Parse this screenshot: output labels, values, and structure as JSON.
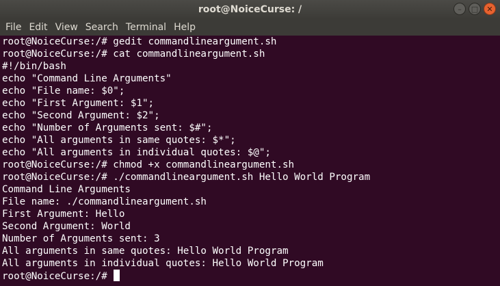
{
  "window": {
    "title": "root@NoiceCurse: /"
  },
  "menu": {
    "items": [
      "File",
      "Edit",
      "View",
      "Search",
      "Terminal",
      "Help"
    ]
  },
  "controls": {
    "minimize_icon": "minimize-icon",
    "maximize_icon": "maximize-icon",
    "close_icon": "close-icon"
  },
  "terminal": {
    "lines": [
      "root@NoiceCurse:/# gedit commandlineargument.sh",
      "root@NoiceCurse:/# cat commandlineargument.sh",
      "#!/bin/bash",
      "echo \"Command Line Arguments\"",
      "echo \"File name: $0\";",
      "echo \"First Argument: $1\";",
      "echo \"Second Argument: $2\";",
      "echo \"Number of Arguments sent: $#\";",
      "echo \"All arguments in same quotes: $*\";",
      "echo \"All arguments in individual quotes: $@\";",
      "root@NoiceCurse:/# chmod +x commandlineargument.sh",
      "root@NoiceCurse:/# ./commandlineargument.sh Hello World Program",
      "Command Line Arguments",
      "File name: ./commandlineargument.sh",
      "First Argument: Hello",
      "Second Argument: World",
      "Number of Arguments sent: 3",
      "All arguments in same quotes: Hello World Program",
      "All arguments in individual quotes: Hello World Program"
    ],
    "prompt": "root@NoiceCurse:/# "
  },
  "colors": {
    "background": "#300a24",
    "foreground": "#ffffff",
    "titlebar": "#3c3b37",
    "close_button": "#e8622f"
  }
}
